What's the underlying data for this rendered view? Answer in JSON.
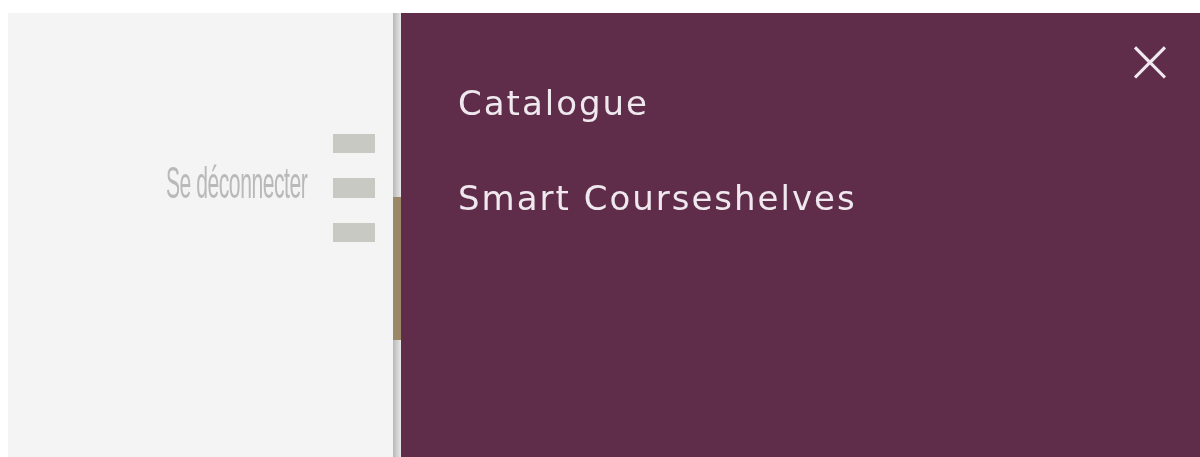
{
  "header": {
    "logout_link": "Se déconnecter"
  },
  "menu": {
    "close": "×",
    "items": [
      {
        "label": "Catalogue"
      },
      {
        "label": "Smart Courseshelves"
      }
    ]
  }
}
